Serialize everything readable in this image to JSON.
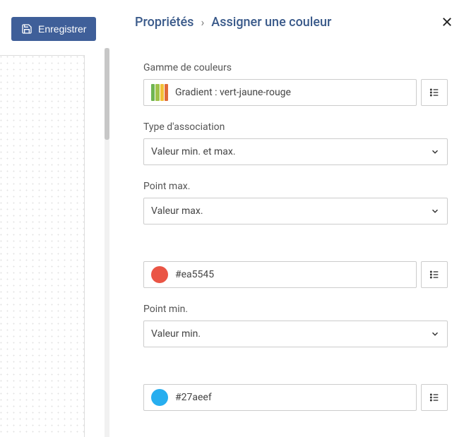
{
  "toolbar": {
    "save_label": "Enregistrer"
  },
  "header": {
    "breadcrumb_root": "Propriétés",
    "breadcrumb_separator": "›",
    "breadcrumb_current": "Assigner une couleur"
  },
  "fields": {
    "color_range": {
      "label": "Gamme de couleurs",
      "value": "Gradient : vert-jaune-rouge",
      "swatch": [
        "#6fb551",
        "#9fc24a",
        "#f2c037",
        "#e06a38"
      ]
    },
    "assoc_type": {
      "label": "Type d'association",
      "value": "Valeur min. et max."
    },
    "point_max": {
      "label": "Point max.",
      "value": "Valeur max."
    },
    "color_max": {
      "value": "#ea5545",
      "swatch": "#ea5545"
    },
    "point_min": {
      "label": "Point min.",
      "value": "Valeur min."
    },
    "color_min": {
      "value": "#27aeef",
      "swatch": "#27aeef"
    }
  }
}
